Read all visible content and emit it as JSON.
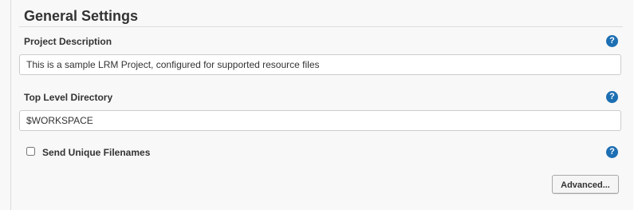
{
  "section": {
    "title": "General Settings"
  },
  "fields": {
    "project_description": {
      "label": "Project Description",
      "value": "This is a sample LRM Project, configured for supported resource files"
    },
    "top_level_directory": {
      "label": "Top Level Directory",
      "value": "$WORKSPACE"
    },
    "send_unique_filenames": {
      "label": "Send Unique Filenames",
      "checked": false
    }
  },
  "help": {
    "glyph": "?",
    "icon": "help-icon",
    "color": "#1d6fb3"
  },
  "buttons": {
    "advanced_label": "Advanced..."
  }
}
